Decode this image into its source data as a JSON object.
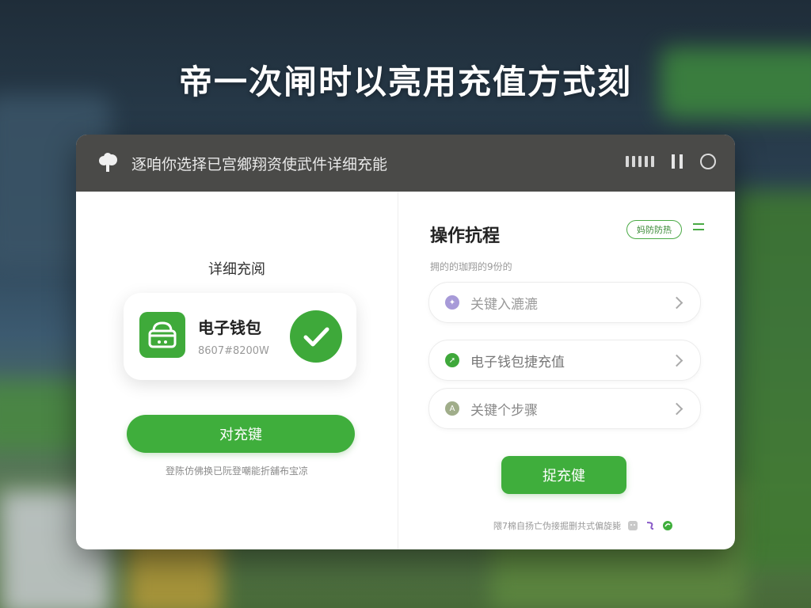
{
  "headline": "帝一次闸时以亮用充值方式刻",
  "dialog": {
    "title": "逐咱你选择已宫鄉翔资使武件详细充能",
    "left": {
      "section_title": "详细充阅",
      "wallet": {
        "name": "电子钱包",
        "sub": "8607#8200W",
        "icon": "wallet-basket-icon",
        "status_icon": "check-icon"
      },
      "primary_button": "对充键",
      "hint": "登陈仿佛换已阮登嘲能折舖布宝凉"
    },
    "right": {
      "title": "操作抗程",
      "pill": "妈防防热",
      "subtitle": "拥的的珈翔的9份的",
      "steps": [
        {
          "label": "关键入漉漉",
          "dot_color": "#a79ad8"
        },
        {
          "label": "电子钱包捷充值",
          "dot_color": "#3fa83b"
        },
        {
          "label": "关键个步骤",
          "dot_color": "#a0ad8a"
        }
      ],
      "action_button": "捉充健",
      "footer": "隈7棉自扬亡伪接掘删共式偏旋毙"
    }
  },
  "colors": {
    "accent": "#3fae3c",
    "titlebar": "#4a4a48"
  }
}
